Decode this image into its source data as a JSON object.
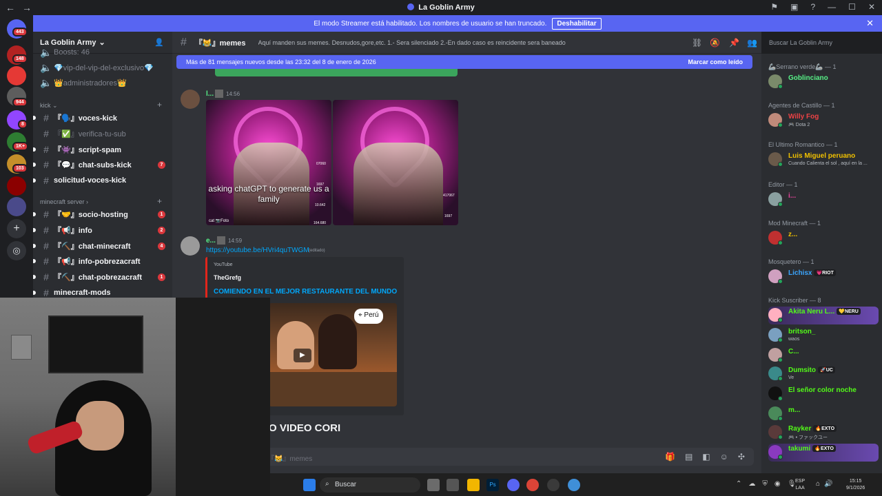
{
  "window": {
    "title": "La Goblin Army"
  },
  "banner": {
    "text": "El modo Streamer está habilitado. Los nombres de usuario se han truncado.",
    "button": "Deshabilitar"
  },
  "rail": {
    "badges": [
      "443",
      "148",
      "944",
      "8",
      "1K+",
      "103"
    ]
  },
  "server": {
    "name": "La Goblin Army"
  },
  "channels": {
    "top": [
      {
        "name": "Boosts: 46"
      },
      {
        "name": "💎vip-del-vip-del-exclusivo💎"
      },
      {
        "name": "👑administradores👑"
      }
    ],
    "cat_kick": "kick",
    "kick": [
      {
        "name": "『🗣️』voces-kick",
        "unread": true
      },
      {
        "name": "『✅』verifica-tu-sub",
        "muted": true
      },
      {
        "name": "『👾』script-spam",
        "unread": true
      },
      {
        "name": "『💬』chat-subs-kick",
        "unread": true,
        "badge": "7"
      },
      {
        "name": "solicitud-voces-kick",
        "unread": true
      }
    ],
    "cat_minecraft": "minecraft server",
    "minecraft": [
      {
        "name": "『🤝』socio-hosting",
        "unread": true,
        "badge": "1"
      },
      {
        "name": "『📢』info",
        "unread": true,
        "badge": "2"
      },
      {
        "name": "『⛏️』chat-minecraft",
        "unread": true,
        "badge": "4"
      },
      {
        "name": "『📢』info-pobrezacraft",
        "unread": true
      },
      {
        "name": "『⛏️』chat-pobrezacraft",
        "unread": true,
        "badge": "1"
      },
      {
        "name": "minecraft-mods",
        "unread": true
      }
    ]
  },
  "header": {
    "channel": "『😹』memes",
    "topic": "Aquí manden sus memes. Desnudos,gore,etc. 1.- Sera silenciado 2.-En dado caso es reincidente sera baneado",
    "search_placeholder": "Buscar La Goblin Army"
  },
  "newbar": {
    "text": "Más de 81 mensajes nuevos desde las 23:32 del 8 de enero de 2026",
    "mark": "Marcar como leído"
  },
  "messages": [
    {
      "user": "l...",
      "time": "14:56",
      "caption": "asking chatGPT to generate us a family",
      "stats_left": [
        "07060",
        "1697",
        "10.642",
        "164.680"
      ],
      "stats_right": [
        "417067",
        "1697"
      ],
      "footer": "cat 📷Foto"
    },
    {
      "user": "e...",
      "time": "14:59",
      "link": "https://youtube.be/HVri4quTWGM",
      "edited": "(editado)",
      "embed": {
        "provider": "YouTube",
        "author": "TheGrefg",
        "title": "COMIENDO EN EL MEJOR RESTAURANTE DEL MUNDO",
        "badge": "Perú"
      }
    }
  ],
  "overlay_text": "O VIDEO CORI",
  "composer": {
    "placeholder": "『😹』memes"
  },
  "members": [
    {
      "category": "🦾Serrano verde🦾 — 1",
      "users": [
        {
          "name": "Goblinciano",
          "color": "#57f287",
          "sub": ""
        }
      ]
    },
    {
      "category": "Agentes de Castillo — 1",
      "users": [
        {
          "name": "Willy Fog",
          "color": "#ed4245",
          "sub": "🎮 Dota 2"
        }
      ]
    },
    {
      "category": "El Ultimo Romantico — 1",
      "users": [
        {
          "name": "Luis Miguel peruano",
          "color": "#f0c000",
          "sub": "Cuando Calienta el sol , aquí en la ..."
        }
      ]
    },
    {
      "category": "Editor — 1",
      "users": [
        {
          "name": "i...",
          "color": "#eb459e",
          "sub": ""
        }
      ]
    },
    {
      "category": "Mod Minecraft — 1",
      "users": [
        {
          "name": "z...",
          "color": "#f0c000",
          "sub": ""
        }
      ]
    },
    {
      "category": "Mosquetero — 1",
      "users": [
        {
          "name": "Lichisx",
          "color": "#3ba6ff",
          "sub": "",
          "tag": "💗RIOT"
        }
      ]
    },
    {
      "category": "Kick Suscriber — 8",
      "users": [
        {
          "name": "Akita Neru L...",
          "color": "#53fc18",
          "sub": "",
          "tag": "💛NERU"
        },
        {
          "name": "britson_",
          "color": "#53fc18",
          "sub": "waos"
        },
        {
          "name": "C...",
          "color": "#53fc18",
          "sub": ""
        },
        {
          "name": "Dumsito",
          "color": "#53fc18",
          "sub": "Ve",
          "tag": "🚀UC"
        },
        {
          "name": "El señor color noche",
          "color": "#53fc18",
          "sub": ""
        },
        {
          "name": "m...",
          "color": "#53fc18",
          "sub": ""
        },
        {
          "name": "Rayker",
          "color": "#53fc18",
          "sub": "🎮 • ファックユー",
          "tag": "🔥EXTO"
        },
        {
          "name": "takumi",
          "color": "#53fc18",
          "sub": "",
          "tag": "🔥EXTO"
        }
      ]
    }
  ],
  "taskbar": {
    "search": "Buscar",
    "lang1": "ESP",
    "lang2": "LAA",
    "time": "15:15",
    "date": "9/1/2026"
  }
}
